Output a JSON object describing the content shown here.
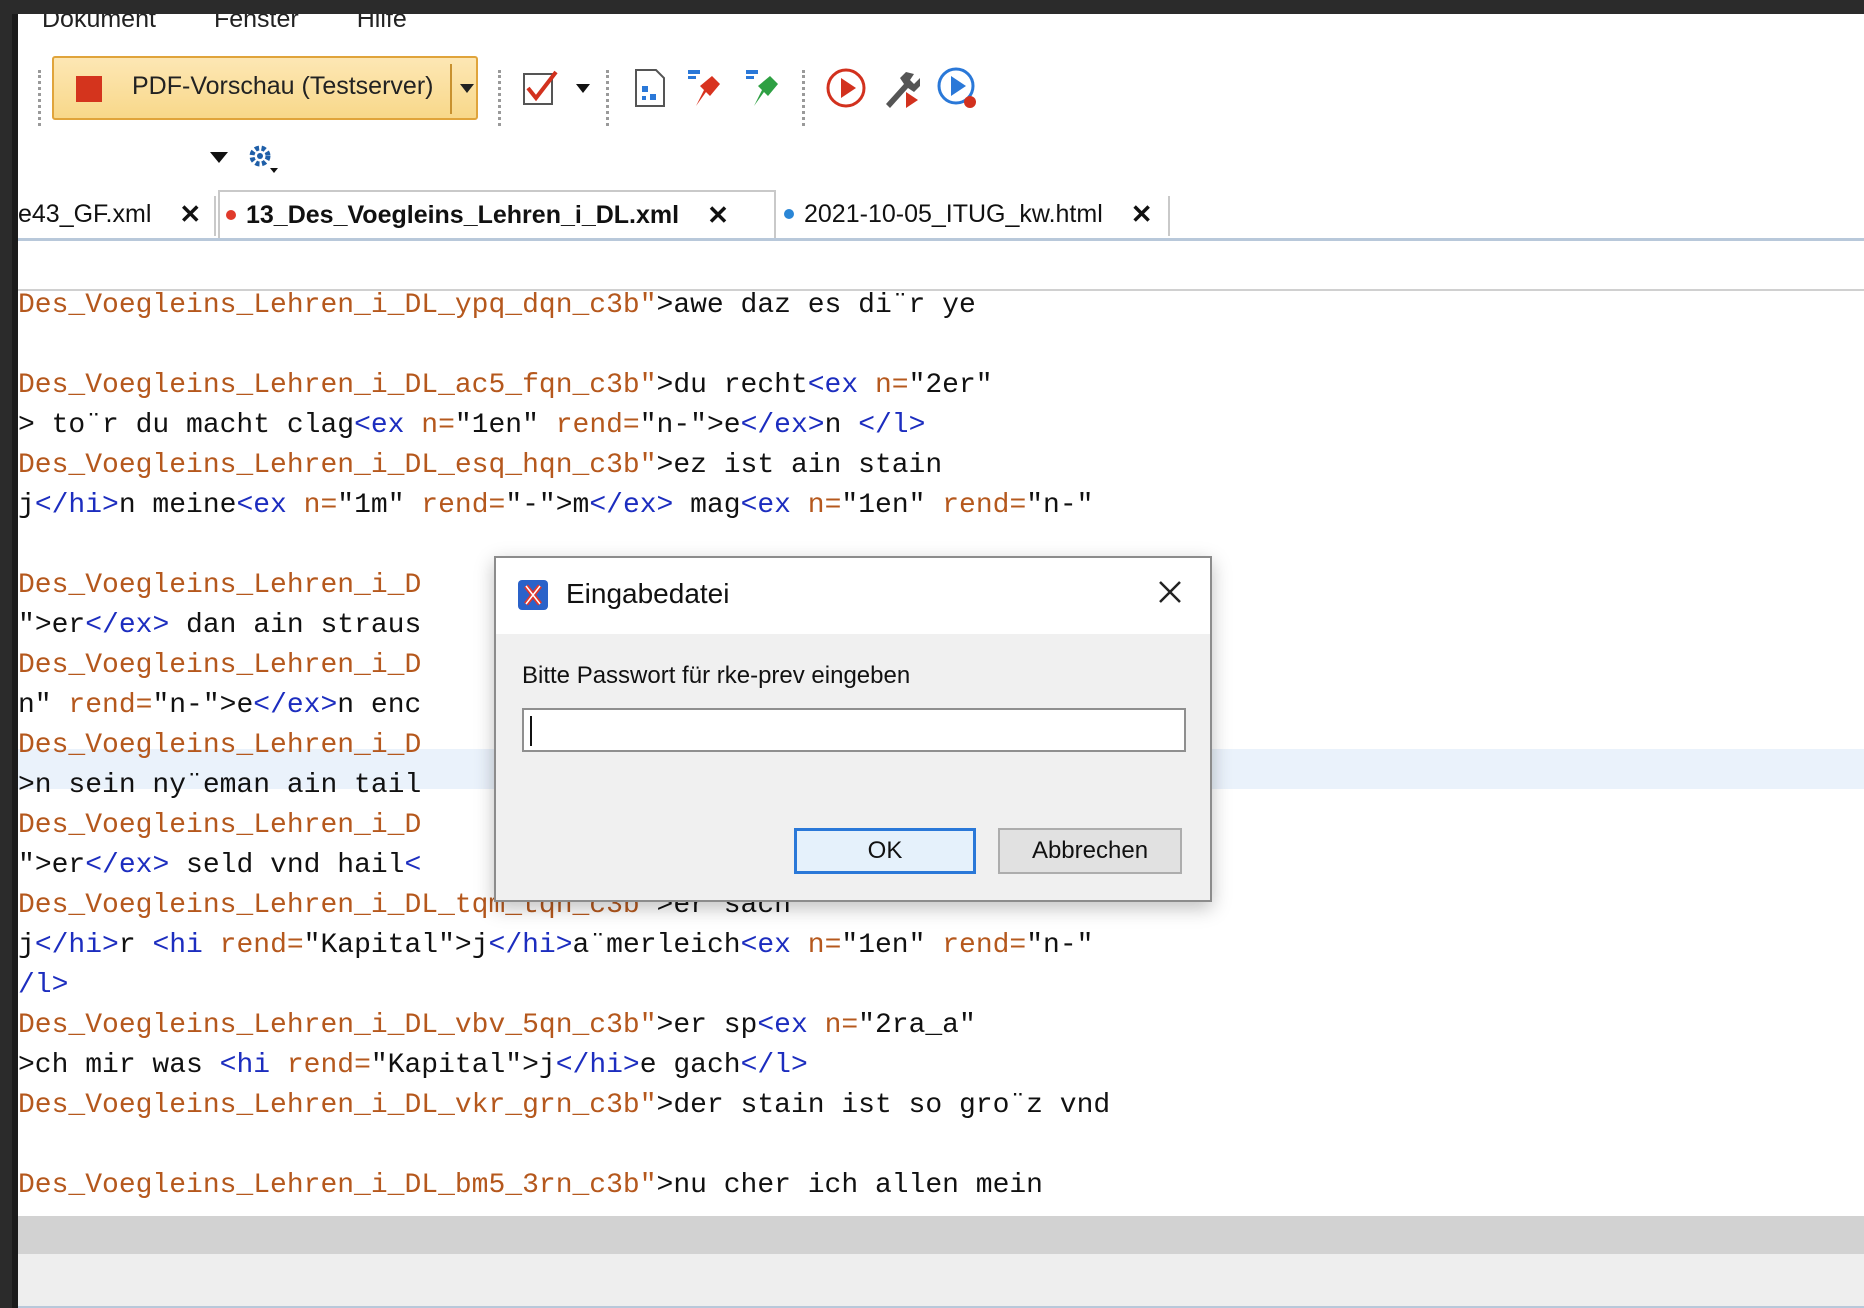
{
  "menu": {
    "items": [
      "Dokument",
      "Fenster",
      "Hilfe"
    ]
  },
  "toolbar": {
    "transform_scenario": "PDF-Vorschau (Testserver)"
  },
  "tabs": [
    {
      "label": "e43_GF.xml",
      "modified": false,
      "active": false
    },
    {
      "label": "13_Des_Voegleins_Lehren_i_DL.xml",
      "modified": true,
      "active": true,
      "dot_color": "#e03a2b"
    },
    {
      "label": "2021-10-05_ITUG_kw.html",
      "modified": true,
      "active": false,
      "dot_color": "#2a86d6"
    }
  ],
  "tab_close_glyph": "✕",
  "editor": {
    "lines": [
      [
        [
          "attr",
          "Des_Voegleins_Lehren_i_DL_ypq_dqn_c3b\""
        ],
        [
          "text",
          ">awe daz es di¨r ye"
        ]
      ],
      [],
      [
        [
          "attr",
          "Des_Voegleins_Lehren_i_DL_ac5_fqn_c3b\""
        ],
        [
          "text",
          ">du recht"
        ],
        [
          "tag",
          "<ex "
        ],
        [
          "attr",
          "n="
        ],
        [
          "val",
          "\"2er\""
        ]
      ],
      [
        [
          "text",
          "> to¨r du macht clag"
        ],
        [
          "tag",
          "<ex "
        ],
        [
          "attr",
          "n="
        ],
        [
          "val",
          "\"1en\" "
        ],
        [
          "attr",
          "rend="
        ],
        [
          "val",
          "\"n-\""
        ],
        [
          "text",
          ">e"
        ],
        [
          "tag",
          "</ex>"
        ],
        [
          "text",
          "n "
        ],
        [
          "tag",
          "</l>"
        ]
      ],
      [
        [
          "attr",
          "Des_Voegleins_Lehren_i_DL_esq_hqn_c3b\""
        ],
        [
          "text",
          ">ez ist ain stain"
        ]
      ],
      [
        [
          "text",
          "j"
        ],
        [
          "tag",
          "</hi>"
        ],
        [
          "text",
          "n meine"
        ],
        [
          "tag",
          "<ex "
        ],
        [
          "attr",
          "n="
        ],
        [
          "val",
          "\"1m\" "
        ],
        [
          "attr",
          "rend="
        ],
        [
          "val",
          "\"-\""
        ],
        [
          "text",
          ">m"
        ],
        [
          "tag",
          "</ex>"
        ],
        [
          "text",
          " mag"
        ],
        [
          "tag",
          "<ex "
        ],
        [
          "attr",
          "n="
        ],
        [
          "val",
          "\"1en\" "
        ],
        [
          "attr",
          "rend="
        ],
        [
          "val",
          "\"n-\""
        ]
      ],
      [],
      [
        [
          "attr",
          "Des_Voegleins_Lehren_i_D"
        ]
      ],
      [
        [
          "val",
          "\""
        ],
        [
          "text",
          ">er"
        ],
        [
          "tag",
          "</ex>"
        ],
        [
          "text",
          " dan ain straus"
        ]
      ],
      [
        [
          "attr",
          "Des_Voegleins_Lehren_i_D"
        ]
      ],
      [
        [
          "val",
          "n\" "
        ],
        [
          "attr",
          "rend="
        ],
        [
          "val",
          "\"n-\""
        ],
        [
          "text",
          ">e"
        ],
        [
          "tag",
          "</ex>"
        ],
        [
          "text",
          "n enc"
        ]
      ],
      [
        [
          "attr",
          "Des_Voegleins_Lehren_i_D"
        ]
      ],
      [
        [
          "text",
          ">n sein ny¨eman ain tail"
        ]
      ],
      [
        [
          "attr",
          "Des_Voegleins_Lehren_i_D"
        ]
      ],
      [
        [
          "val",
          "\""
        ],
        [
          "text",
          ">er"
        ],
        [
          "tag",
          "</ex>"
        ],
        [
          "text",
          " seld vnd hail"
        ],
        [
          "tag",
          "<"
        ]
      ],
      [
        [
          "attr",
          "Des_Voegleins_Lehren_i_DL_tqm_tqn_c3b\""
        ],
        [
          "text",
          ">er sach"
        ]
      ],
      [
        [
          "text",
          "j"
        ],
        [
          "tag",
          "</hi>"
        ],
        [
          "text",
          "r "
        ],
        [
          "tag",
          "<hi "
        ],
        [
          "attr",
          "rend="
        ],
        [
          "val",
          "\"Kapital\""
        ],
        [
          "text",
          ">j"
        ],
        [
          "tag",
          "</hi>"
        ],
        [
          "text",
          "a¨merleich"
        ],
        [
          "tag",
          "<ex "
        ],
        [
          "attr",
          "n="
        ],
        [
          "val",
          "\"1en\" "
        ],
        [
          "attr",
          "rend="
        ],
        [
          "val",
          "\"n-\""
        ]
      ],
      [
        [
          "tag",
          "/l>"
        ]
      ],
      [
        [
          "attr",
          "Des_Voegleins_Lehren_i_DL_vbv_5qn_c3b\""
        ],
        [
          "text",
          ">er sp"
        ],
        [
          "tag",
          "<ex "
        ],
        [
          "attr",
          "n="
        ],
        [
          "val",
          "\"2ra_a\""
        ]
      ],
      [
        [
          "text",
          ">ch mir was "
        ],
        [
          "tag",
          "<hi "
        ],
        [
          "attr",
          "rend="
        ],
        [
          "val",
          "\"Kapital\""
        ],
        [
          "text",
          ">j"
        ],
        [
          "tag",
          "</hi>"
        ],
        [
          "text",
          "e gach"
        ],
        [
          "tag",
          "</l>"
        ]
      ],
      [
        [
          "attr",
          "Des_Voegleins_Lehren_i_DL_vkr_grn_c3b\""
        ],
        [
          "text",
          ">der stain ist so gro¨z vnd"
        ]
      ],
      [],
      [
        [
          "attr",
          "Des_Voegleins_Lehren_i_DL_bm5_3rn_c3b\""
        ],
        [
          "text",
          ">nu cher ich allen mein"
        ]
      ]
    ],
    "highlighted_line_index": 11
  },
  "dialog": {
    "title": "Eingabedatei",
    "prompt": "Bitte Passwort für rke-prev eingeben",
    "password_value": "",
    "ok_label": "OK",
    "cancel_label": "Abbrechen"
  },
  "colors": {
    "accent": "#2a78d8",
    "attr": "#b5581d",
    "tag": "#1c2dbf"
  }
}
